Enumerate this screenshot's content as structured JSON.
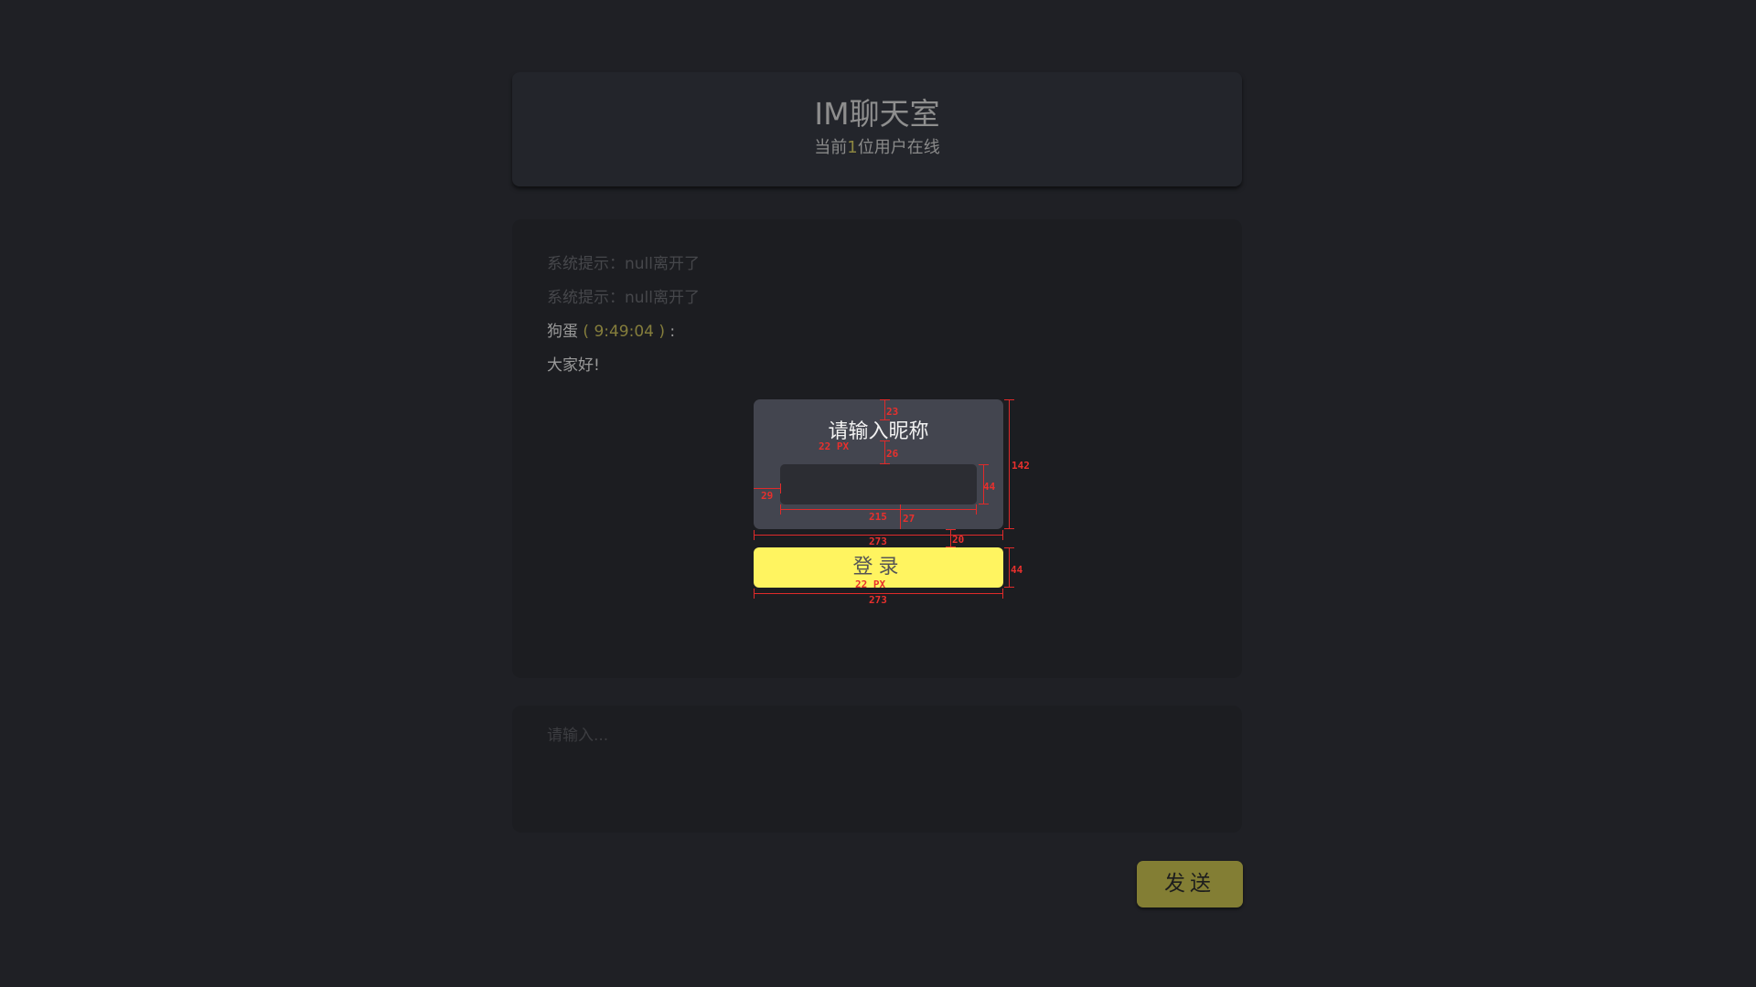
{
  "header": {
    "title": "IM聊天室",
    "online_prefix": "当前",
    "online_count": "1",
    "online_suffix": "位用户在线"
  },
  "messages": [
    {
      "type": "system",
      "text": "系统提示：null离开了"
    },
    {
      "type": "system",
      "text": "系统提示：null离开了"
    },
    {
      "type": "user",
      "user": "狗蛋",
      "time": " ( 9:49:04 ) ",
      "colon": ":"
    },
    {
      "type": "text",
      "text": "大家好!"
    }
  ],
  "login": {
    "prompt": "请输入昵称",
    "nickname_value": "",
    "button_label": "登录"
  },
  "annotations": {
    "card_top_gap": "23",
    "title_font": "22 PX",
    "title_bottom_gap": "26",
    "card_height": "142",
    "input_left_gap": "29",
    "input_height": "44",
    "input_width": "215",
    "input_bottom_gap": "27",
    "card_width": "273",
    "button_gap": "20",
    "button_height": "44",
    "button_font": "22 PX",
    "button_width": "273"
  },
  "compose": {
    "placeholder": "请输入...",
    "value": "",
    "send_label": "发送"
  },
  "colors": {
    "background": "#1f2025",
    "accent_yellow": "#fff460",
    "send_button": "#837e34",
    "measure_red": "#e02a2a"
  }
}
